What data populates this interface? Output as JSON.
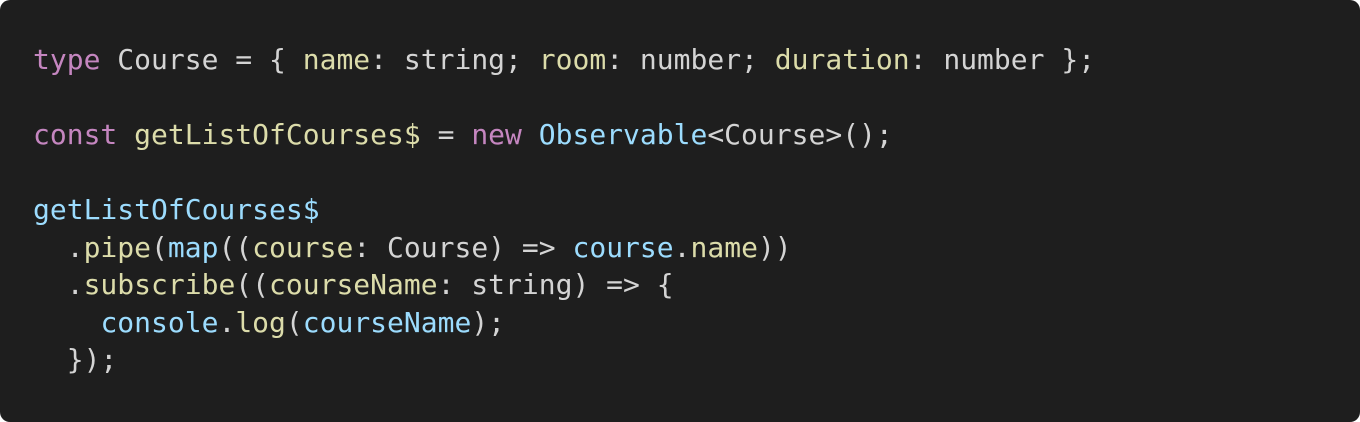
{
  "colors": {
    "background": "#1e1e1e",
    "keyword": "#c586c0",
    "function": "#dcdcaa",
    "variable": "#9cdcfe",
    "plain": "#d4d4d4"
  },
  "code": {
    "line1": [
      {
        "text": "type",
        "kind": "keyword"
      },
      {
        "text": " Course = { ",
        "kind": "punct"
      },
      {
        "text": "name",
        "kind": "prop"
      },
      {
        "text": ": string; ",
        "kind": "punct"
      },
      {
        "text": "room",
        "kind": "prop"
      },
      {
        "text": ": number; ",
        "kind": "punct"
      },
      {
        "text": "duration",
        "kind": "prop"
      },
      {
        "text": ": number };",
        "kind": "punct"
      }
    ],
    "line2": [
      {
        "text": "const",
        "kind": "keyword"
      },
      {
        "text": " ",
        "kind": "punct"
      },
      {
        "text": "getListOfCourses$",
        "kind": "func"
      },
      {
        "text": " = ",
        "kind": "punct"
      },
      {
        "text": "new",
        "kind": "keyword"
      },
      {
        "text": " ",
        "kind": "punct"
      },
      {
        "text": "Observable",
        "kind": "class"
      },
      {
        "text": "<Course>();",
        "kind": "punct"
      }
    ],
    "line3": [
      {
        "text": "getListOfCourses$",
        "kind": "var"
      }
    ],
    "line4": [
      {
        "text": "  .",
        "kind": "punct"
      },
      {
        "text": "pipe",
        "kind": "func"
      },
      {
        "text": "(",
        "kind": "punct"
      },
      {
        "text": "map",
        "kind": "var"
      },
      {
        "text": "((",
        "kind": "punct"
      },
      {
        "text": "course",
        "kind": "prop"
      },
      {
        "text": ": Course) => ",
        "kind": "punct"
      },
      {
        "text": "course",
        "kind": "var"
      },
      {
        "text": ".",
        "kind": "punct"
      },
      {
        "text": "name",
        "kind": "prop"
      },
      {
        "text": "))",
        "kind": "punct"
      }
    ],
    "line5": [
      {
        "text": "  .",
        "kind": "punct"
      },
      {
        "text": "subscribe",
        "kind": "func"
      },
      {
        "text": "((",
        "kind": "punct"
      },
      {
        "text": "courseName",
        "kind": "prop"
      },
      {
        "text": ": string) => {",
        "kind": "punct"
      }
    ],
    "line6": [
      {
        "text": "    ",
        "kind": "punct"
      },
      {
        "text": "console",
        "kind": "var"
      },
      {
        "text": ".",
        "kind": "punct"
      },
      {
        "text": "log",
        "kind": "func"
      },
      {
        "text": "(",
        "kind": "punct"
      },
      {
        "text": "courseName",
        "kind": "var"
      },
      {
        "text": ");",
        "kind": "punct"
      }
    ],
    "line7": [
      {
        "text": "  });",
        "kind": "punct"
      }
    ]
  }
}
